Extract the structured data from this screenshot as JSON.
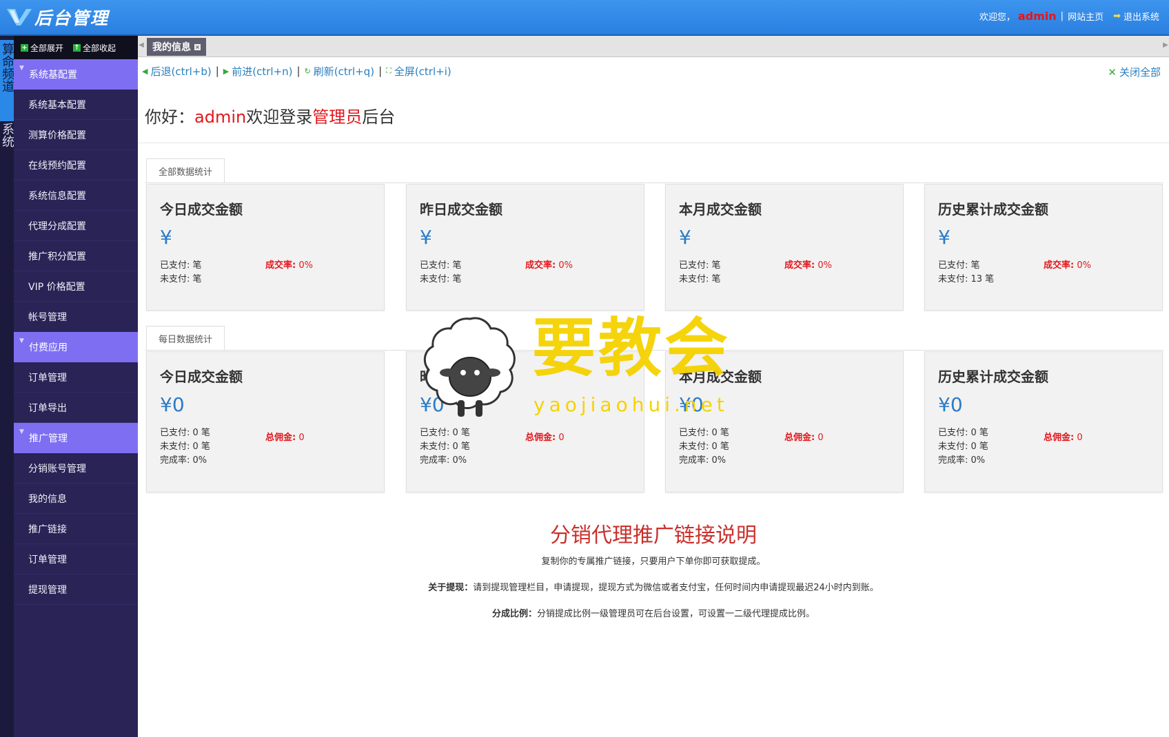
{
  "header": {
    "logo_text": "后台管理",
    "welcome": "欢迎您，",
    "username": "admin",
    "home_link": "网站主页",
    "logout": "退出系统"
  },
  "channels": [
    "算命频道",
    "系统"
  ],
  "menu": {
    "expand_all": "全部展开",
    "collapse_all": "全部收起",
    "groups": [
      {
        "title": "系统基配置",
        "items": [
          "系统基本配置",
          "测算价格配置",
          "在线预约配置",
          "系统信息配置",
          "代理分成配置",
          "推广积分配置",
          "VIP 价格配置",
          "帐号管理"
        ]
      },
      {
        "title": "付费应用",
        "items": [
          "订单管理",
          "订单导出"
        ]
      },
      {
        "title": "推广管理",
        "items": [
          "分销账号管理",
          "我的信息",
          "推广链接",
          "订单管理",
          "提现管理"
        ]
      }
    ]
  },
  "tabs": [
    {
      "label": "我的信息",
      "active": true
    }
  ],
  "nav": {
    "back": "后退(ctrl+b)",
    "forward": "前进(ctrl+n)",
    "refresh": "刷新(ctrl+q)",
    "fullscreen": "全屏(ctrl+i)",
    "close_all": "关闭全部"
  },
  "greeting": {
    "prefix": "你好：",
    "user": "admin",
    "middle": "欢迎登录",
    "role": "管理员",
    "suffix": "后台"
  },
  "total_section": {
    "tab": "全部数据统计",
    "cards": [
      {
        "title": "今日成交金额",
        "amount": "¥",
        "paid": "已支付: 笔",
        "unpaid": "未支付: 笔",
        "rate_label": "成交率:",
        "rate_value": "0%"
      },
      {
        "title": "昨日成交金额",
        "amount": "¥",
        "paid": "已支付: 笔",
        "unpaid": "未支付: 笔",
        "rate_label": "成交率:",
        "rate_value": "0%"
      },
      {
        "title": "本月成交金额",
        "amount": "¥",
        "paid": "已支付: 笔",
        "unpaid": "未支付: 笔",
        "rate_label": "成交率:",
        "rate_value": "0%"
      },
      {
        "title": "历史累计成交金额",
        "amount": "¥",
        "paid": "已支付: 笔",
        "unpaid": "未支付: 13 笔",
        "rate_label": "成交率:",
        "rate_value": "0%"
      }
    ]
  },
  "daily_section": {
    "tab": "每日数据统计",
    "cards": [
      {
        "title": "今日成交金额",
        "amount": "¥0",
        "paid": "已支付: 0 笔",
        "unpaid": "未支付: 0 笔",
        "complete": "完成率: 0%",
        "comm_label": "总佣金:",
        "comm_value": "0"
      },
      {
        "title": "昨日成交金额",
        "amount": "¥0",
        "paid": "已支付: 0 笔",
        "unpaid": "未支付: 0 笔",
        "complete": "完成率: 0%",
        "comm_label": "总佣金:",
        "comm_value": "0"
      },
      {
        "title": "本月成交金额",
        "amount": "¥0",
        "paid": "已支付: 0 笔",
        "unpaid": "未支付: 0 笔",
        "complete": "完成率: 0%",
        "comm_label": "总佣金:",
        "comm_value": "0"
      },
      {
        "title": "历史累计成交金额",
        "amount": "¥0",
        "paid": "已支付: 0 笔",
        "unpaid": "未支付: 0 笔",
        "complete": "完成率: 0%",
        "comm_label": "总佣金:",
        "comm_value": "0"
      }
    ]
  },
  "explanation": {
    "title": "分销代理推广链接说明",
    "line1": "复制你的专属推广链接，只要用户下单你即可获取提成。",
    "line2_label": "关于提现：",
    "line2": "请到提现管理栏目，申请提现，提现方式为微信或者支付宝，任何时间内申请提现最迟24小时内到账。",
    "line3_label": "分成比例：",
    "line3": "分销提成比例一级管理员可在后台设置，可设置一二级代理提成比例。"
  },
  "watermark": {
    "title": "要教会",
    "sub": "yaojiaohui.net"
  },
  "colors": {
    "header": "#2a7fe0",
    "menu_bg": "#2a2356",
    "menu_group": "#7e6ff2",
    "accent_red": "#e3161b",
    "amount_blue": "#2b7cc6"
  }
}
